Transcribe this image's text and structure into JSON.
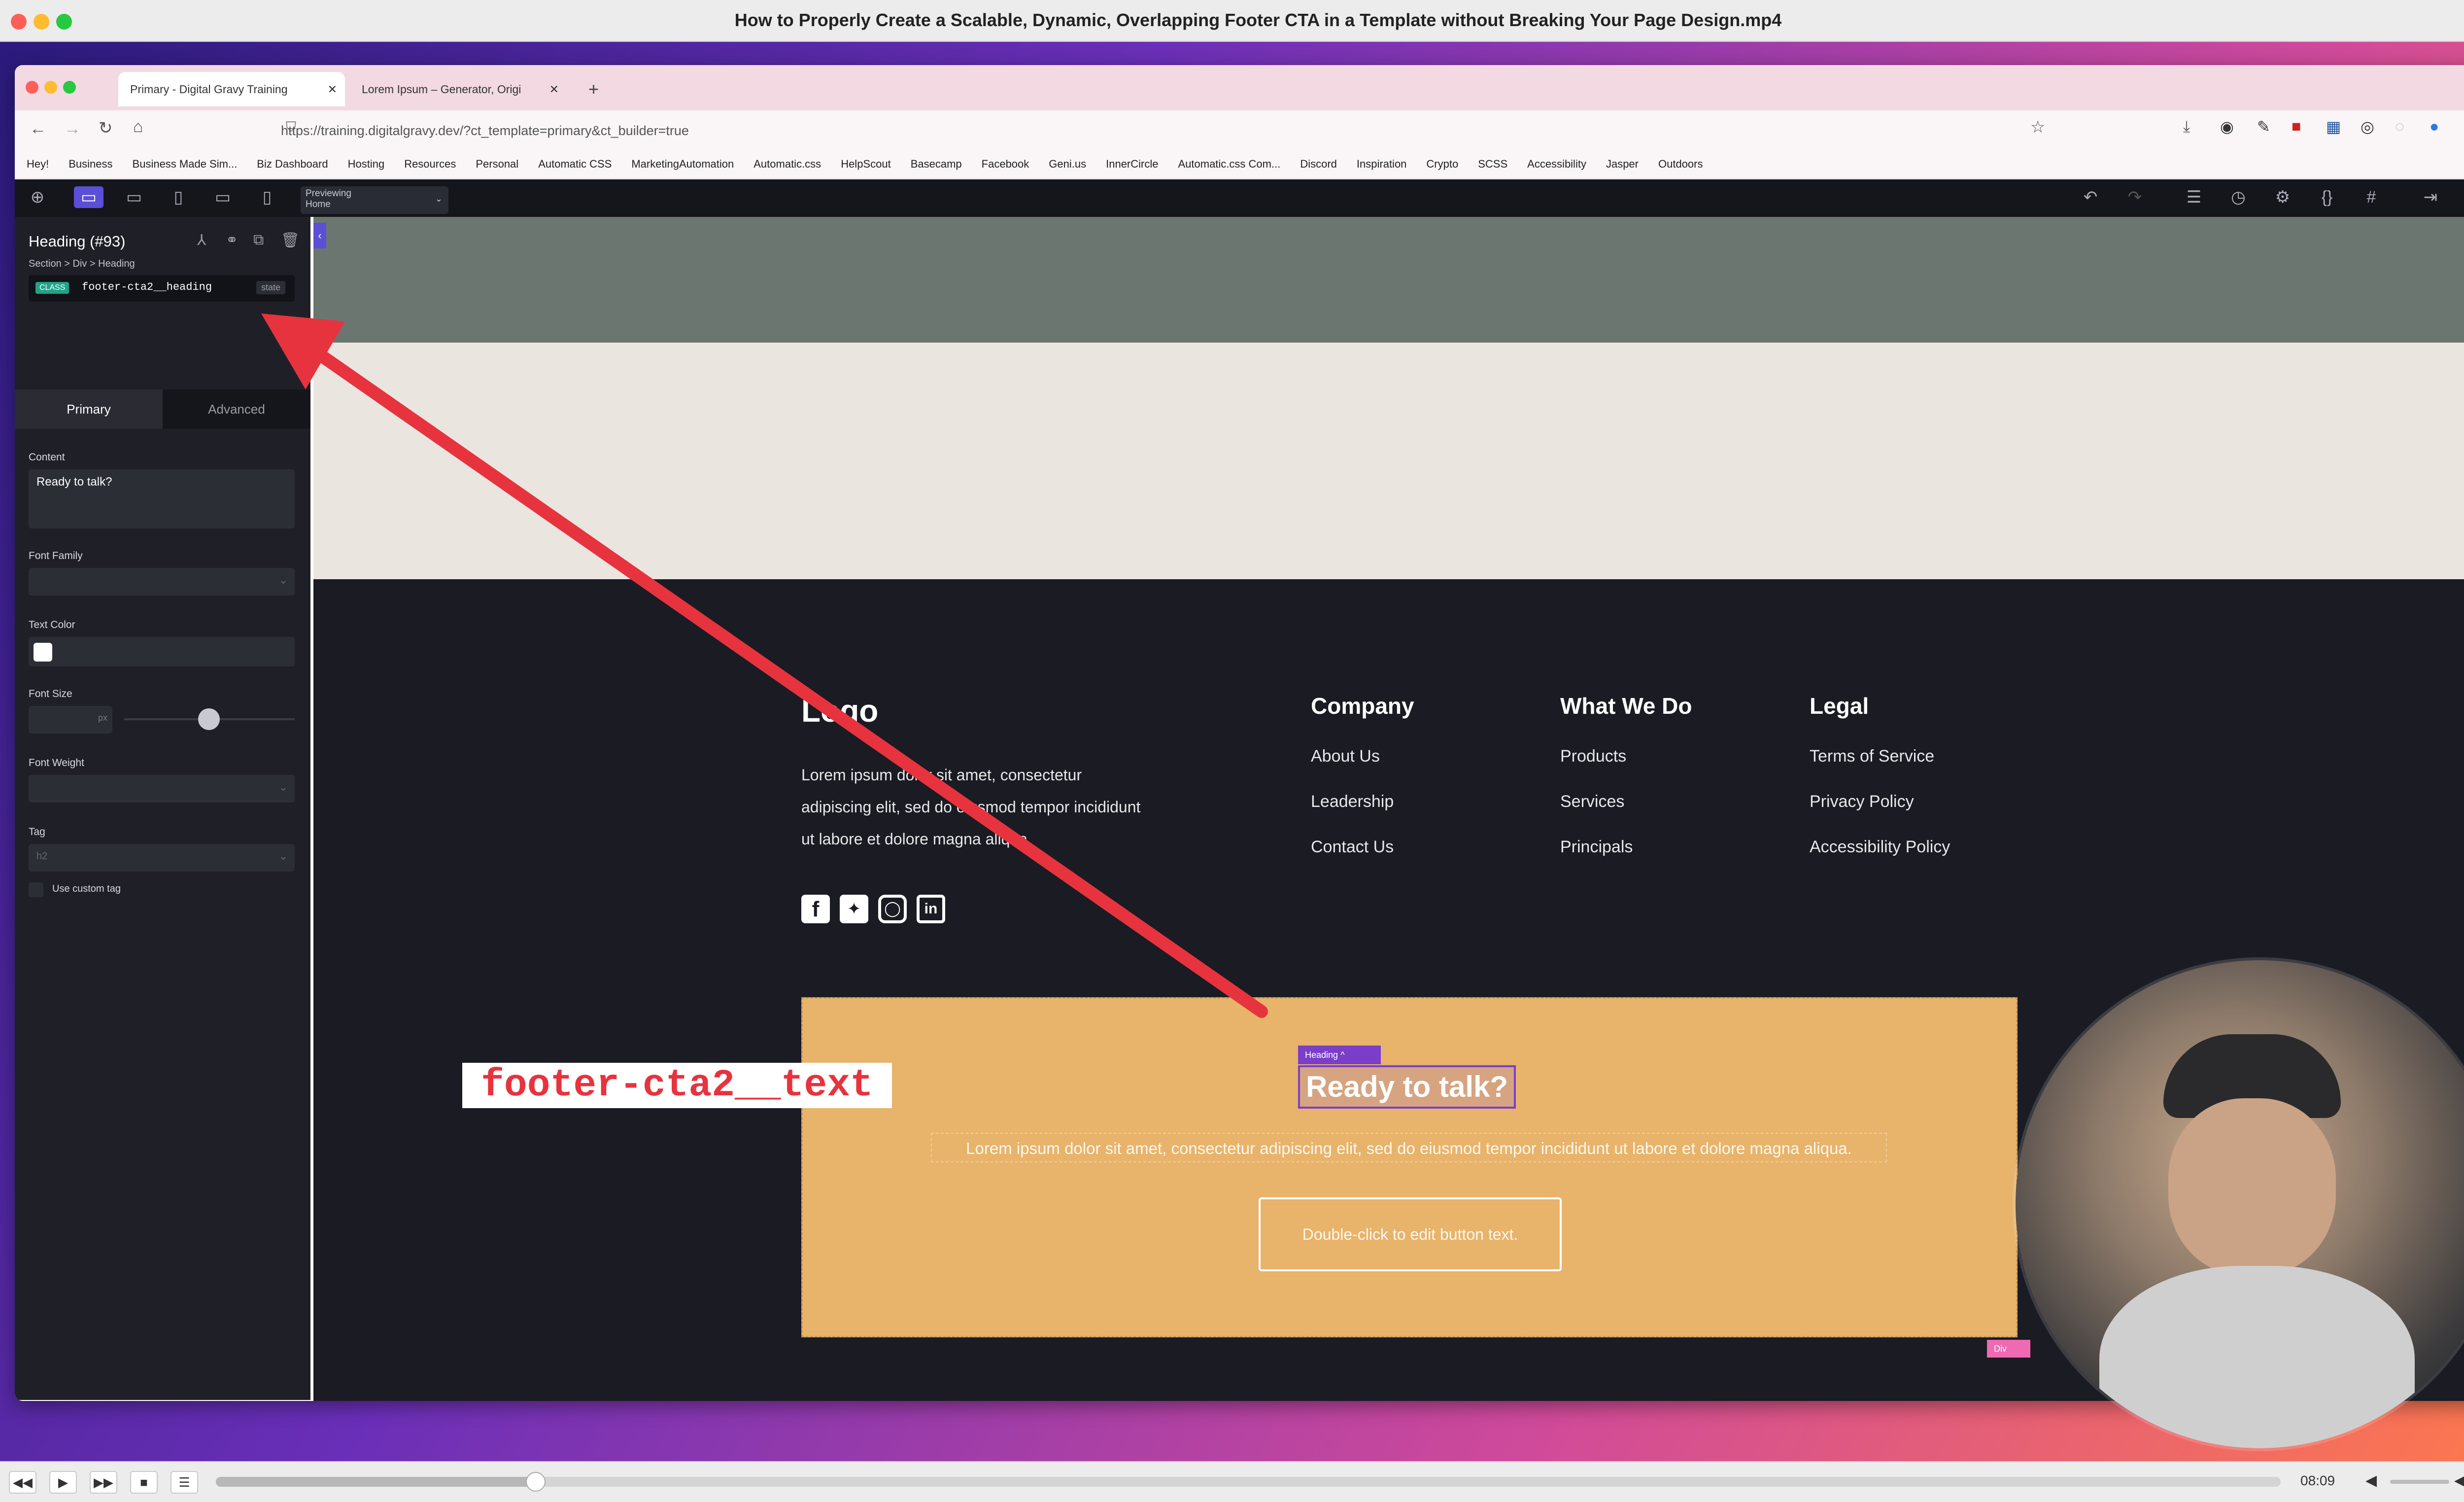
{
  "player": {
    "title": "How to Properly Create a Scalable, Dynamic, Overlapping Footer CTA in a Template without Breaking Your Page Design.mp4",
    "time": "08:09",
    "progress": 0.155
  },
  "browser": {
    "tabs": [
      {
        "label": "Primary - Digital Gravy Training",
        "active": true
      },
      {
        "label": "Lorem Ipsum – Generator, Origi",
        "active": false
      }
    ],
    "url": "https://training.digitalgravy.dev/?ct_template=primary&ct_builder=true",
    "bookmarks": [
      "Hey!",
      "Business",
      "Business Made Sim...",
      "Biz Dashboard",
      "Hosting",
      "Resources",
      "Personal",
      "Automatic CSS",
      "MarketingAutomation",
      "Automatic.css",
      "HelpScout",
      "Basecamp",
      "Facebook",
      "Geni.us",
      "InnerCircle",
      "Automatic.css Com...",
      "Discord",
      "Inspiration",
      "Crypto",
      "SCSS",
      "Accessibility",
      "Jasper",
      "Outdoors"
    ]
  },
  "toolbar": {
    "previewing_label": "Previewing",
    "previewing_value": "Home"
  },
  "panel": {
    "element_title": "Heading (#93)",
    "breadcrumb": "Section > Div > Heading",
    "class_badge": "CLASS",
    "class_name": "footer-cta2__heading",
    "state_label": "state",
    "tabs": [
      "Primary",
      "Advanced"
    ],
    "content_label": "Content",
    "content_value": "Ready to talk?",
    "font_family_label": "Font Family",
    "text_color_label": "Text Color",
    "font_size_label": "Font Size",
    "font_size_unit": "px",
    "font_weight_label": "Font Weight",
    "tag_label": "Tag",
    "tag_value": "h2",
    "custom_tag_label": "Use custom tag"
  },
  "footer": {
    "logo": "Logo",
    "description_lines": [
      "Lorem ipsum dolor sit amet, consectetur",
      "adipiscing elit, sed do eiusmod tempor incididunt",
      "ut labore et dolore magna aliqua."
    ],
    "columns": [
      {
        "heading": "Company",
        "links": [
          "About Us",
          "Leadership",
          "Contact Us"
        ]
      },
      {
        "heading": "What We Do",
        "links": [
          "Products",
          "Services",
          "Principals"
        ]
      },
      {
        "heading": "Legal",
        "links": [
          "Terms of Service",
          "Privacy Policy",
          "Accessibility Policy"
        ]
      }
    ],
    "social_icons": [
      "facebook-icon",
      "twitter-icon",
      "instagram-icon",
      "linkedin-icon"
    ]
  },
  "cta": {
    "tag_label": "Heading",
    "heading": "Ready to talk?",
    "text": "Lorem ipsum dolor sit amet, consectetur adipiscing elit, sed do eiusmod tempor incididunt ut labore et dolore magna aliqua.",
    "button": "Double-click to edit button text.",
    "div_tag": "Div"
  },
  "overlay_label": "footer-cta2__text",
  "colors": {
    "accent_purple": "#7a3ec9",
    "cta_background": "#e8b36a",
    "arrow_red": "#e7333e",
    "footer_bg": "#1a1b23"
  }
}
